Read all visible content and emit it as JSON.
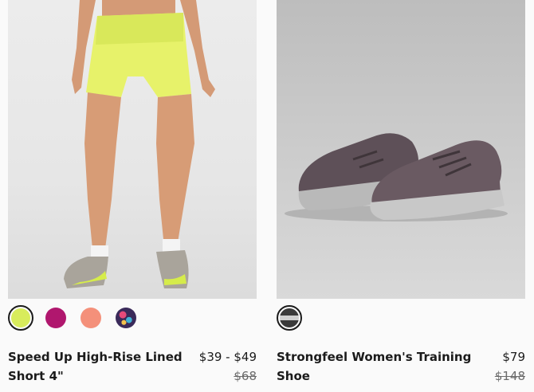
{
  "products": [
    {
      "name": "Speed Up High-Rise Lined Short 4\"",
      "price": "$39 - $49",
      "original_price": "$68",
      "image": "model-wearing-yellow-shorts-and-sneakers",
      "swatches": [
        {
          "name": "lime",
          "color": "#d8ec5c",
          "selected": true
        },
        {
          "name": "magenta",
          "color": "#b0176e",
          "selected": false
        },
        {
          "name": "coral",
          "color": "#f4907a",
          "selected": false
        },
        {
          "name": "print",
          "color": "#3a2a5a",
          "selected": false
        }
      ]
    },
    {
      "name": "Strongfeel Women's Training Shoe",
      "price": "$79",
      "original_price": "$148",
      "image": "pair-of-grey-purple-training-shoes",
      "swatches": [
        {
          "name": "grey",
          "color": "#6e6e6e",
          "selected": true
        }
      ]
    }
  ]
}
